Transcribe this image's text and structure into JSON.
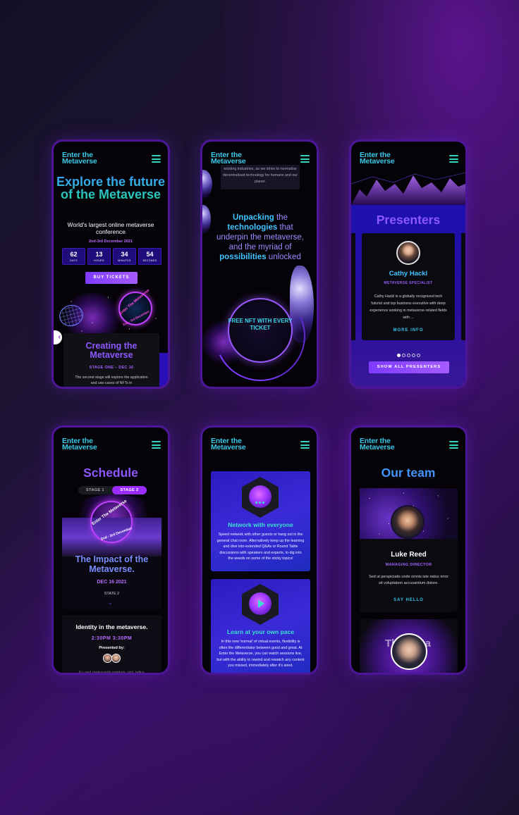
{
  "brand": "Enter the Metaverse",
  "screens": {
    "home": {
      "hero_title": "Explore the future of the Metaverse",
      "subtitle": "World's largest online metaverse conference",
      "date": "2nd-3rd December 2021",
      "countdown": [
        {
          "value": "62",
          "label": "DAYS"
        },
        {
          "value": "13",
          "label": "HOURS"
        },
        {
          "value": "34",
          "label": "MINUTES"
        },
        {
          "value": "54",
          "label": "SECONDS"
        }
      ],
      "cta": "BUY TICKETS",
      "badge_text": "Enter The Metaverse",
      "badge_date": "2nd - 3rd December",
      "card_title": "Creating the Metaverse",
      "card_stage": "STAGE ONE – DEC 16",
      "card_body": "The second stage will explore the application and use-cases of NFTs in"
    },
    "about": {
      "fade_text": "existing industries, as we strive to normalise decentralised technology for humans and our planet.",
      "headline_parts": [
        {
          "text": "Unpacking",
          "hl": true
        },
        {
          "text": " the ",
          "hl": false
        },
        {
          "text": "technologies",
          "hl": true
        },
        {
          "text": " that underpin the metaverse, and the myriad of ",
          "hl": false
        },
        {
          "text": "possibilities",
          "hl": true
        },
        {
          "text": " unlocked",
          "hl": false
        }
      ],
      "nft_badge": "FREE NFT WITH EVERY TICKET"
    },
    "presenters": {
      "title": "Presenters",
      "name": "Cathy Hackl",
      "role": "METAVERSE SPECIALIST",
      "bio": "Cathy Hackl is a globally recognized tech futurist and top business executive with deep experience working in metaverse-related fields with ...",
      "more": "MORE INFO",
      "dots": 5,
      "active_dot": 0,
      "cta": "SHOW ALL PRESENTERS"
    },
    "schedule": {
      "title": "Schedule",
      "tabs": [
        "STAGE 1",
        "STAGE 2"
      ],
      "active_tab": 1,
      "badge_text": "Enter The Metaverse",
      "badge_date": "2nd - 3rd December",
      "event_title": "The Impact of the Metaverse.",
      "event_date": "DEC 16 2021",
      "event_state": "STATE 2",
      "talk_title": "Identity in the metaverse.",
      "talk_time": "2:30PM  3:30PM",
      "presented_by": "Presented by:",
      "talk_body": "Eu sed malesuada pretium, nisl, tellus"
    },
    "features": [
      {
        "title": "Network with everyone",
        "body": "Speed network with other guests or hang out in the general chat room. Alternatively keep up the learning and dive into extended Q&As or Round Table discussions with speakers and experts, to dig into the weeds on some of the sticky topics!"
      },
      {
        "title": "Learn at your own pace",
        "body": "In this new 'normal' of virtual events, flexibility is often the differentiator between good and great. At Enter the Metaverse, you can watch sessions live, but with the ability to rewind and rewatch any content you missed, immediately after it's aired."
      }
    ],
    "team": {
      "title": "Our team",
      "name": "Luke Reed",
      "role": "MANAGING DIRECTOR",
      "bio": "Sed ut perspiciatis unde omnis iste natus error sit voluptatem accusantium dolore.",
      "cta": "SAY HELLO",
      "next_card_text": "The Meta"
    }
  },
  "colors": {
    "accent_teal": "#39c8e6",
    "accent_purple": "#8d58ff",
    "button_purple": "#9b2cff",
    "frame": "#4d1698"
  }
}
